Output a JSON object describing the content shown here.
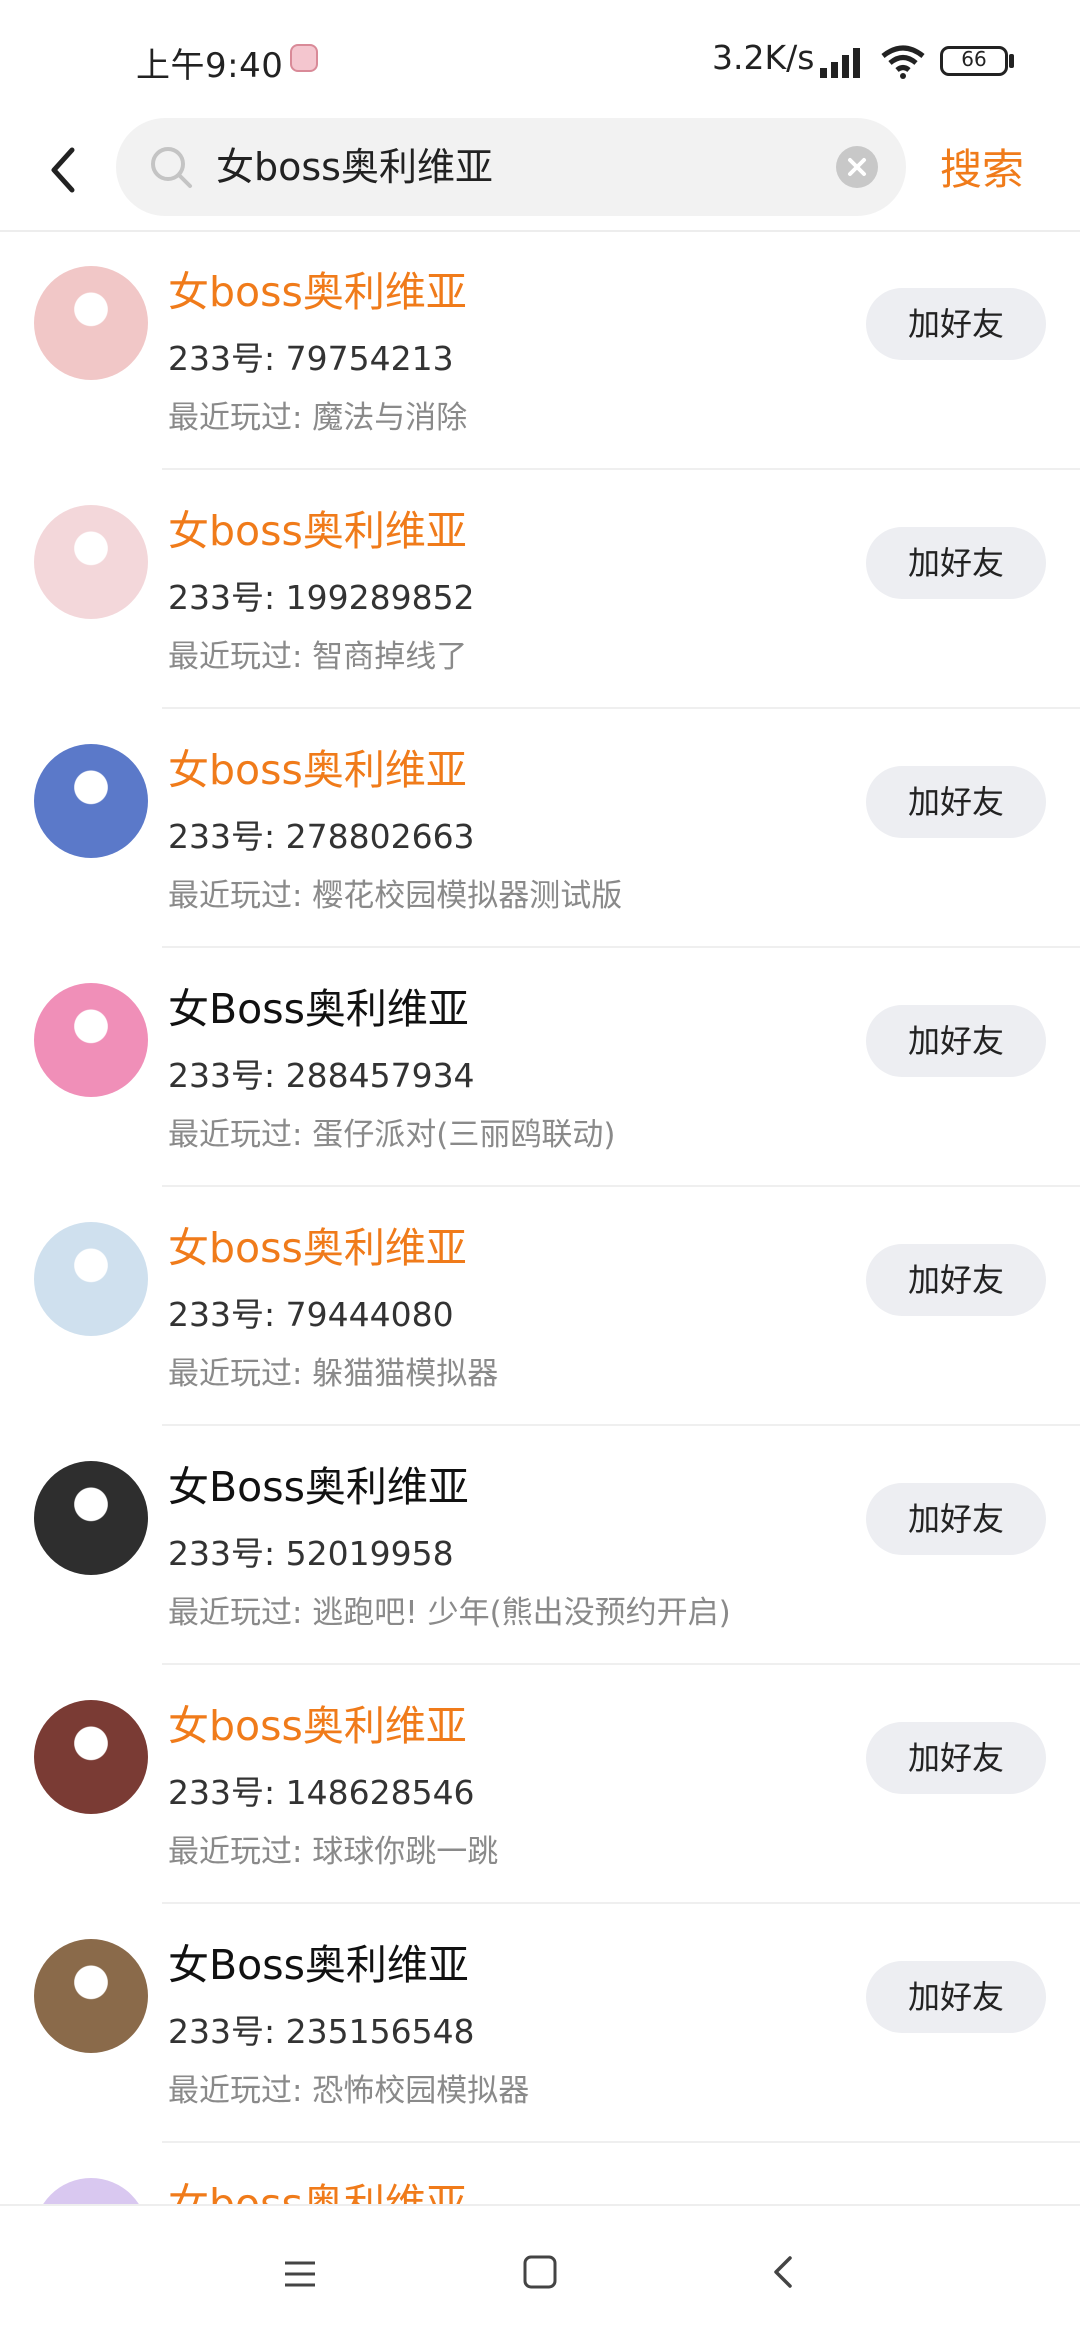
{
  "status_bar": {
    "time": "上午9:40",
    "net_speed": "3.2K/s",
    "battery": "66"
  },
  "search": {
    "query": "女boss奥利维亚",
    "submit_label": "搜索"
  },
  "results": [
    {
      "name": "女boss奥利维亚",
      "highlight": true,
      "id_line": "233号: 79754213",
      "recent_line": "最近玩过: 魔法与消除",
      "button": "加好友",
      "avatar_color": "#f1c7c7"
    },
    {
      "name": "女boss奥利维亚",
      "highlight": true,
      "id_line": "233号: 199289852",
      "recent_line": "最近玩过: 智商掉线了",
      "button": "加好友",
      "avatar_color": "#f3d7da"
    },
    {
      "name": "女boss奥利维亚",
      "highlight": true,
      "id_line": "233号: 278802663",
      "recent_line": "最近玩过: 樱花校园模拟器测试版",
      "button": "加好友",
      "avatar_color": "#5b79c9"
    },
    {
      "name": "女Boss奥利维亚",
      "highlight": false,
      "id_line": "233号: 288457934",
      "recent_line": "最近玩过: 蛋仔派对(三丽鸥联动)",
      "button": "加好友",
      "avatar_color": "#f08fb8"
    },
    {
      "name": "女boss奥利维亚",
      "highlight": true,
      "id_line": "233号: 79444080",
      "recent_line": "最近玩过: 躲猫猫模拟器",
      "button": "加好友",
      "avatar_color": "#cfe0ee"
    },
    {
      "name": "女Boss奥利维亚",
      "highlight": false,
      "id_line": "233号: 52019958",
      "recent_line": "最近玩过: 逃跑吧! 少年(熊出没预约开启)",
      "button": "加好友",
      "avatar_color": "#2e2e2e"
    },
    {
      "name": "女boss奥利维亚",
      "highlight": true,
      "id_line": "233号: 148628546",
      "recent_line": "最近玩过: 球球你跳一跳",
      "button": "加好友",
      "avatar_color": "#7a3b34"
    },
    {
      "name": "女Boss奥利维亚",
      "highlight": false,
      "id_line": "233号: 235156548",
      "recent_line": "最近玩过: 恐怖校园模拟器",
      "button": "加好友",
      "avatar_color": "#8a6a4a"
    },
    {
      "name": "女boss奥利维亚。",
      "highlight": true,
      "id_line": "",
      "recent_line": "",
      "button": "",
      "avatar_color": "#d9c8f0"
    }
  ],
  "colors": {
    "accent": "#f07b1a",
    "button_bg": "#edeef2"
  },
  "icons": {
    "back": "chevron-left-icon",
    "search": "magnifier-icon",
    "clear": "close-circle-icon",
    "nav_menu": "menu-icon",
    "nav_home": "home-square-icon",
    "nav_back": "chevron-left-icon"
  }
}
